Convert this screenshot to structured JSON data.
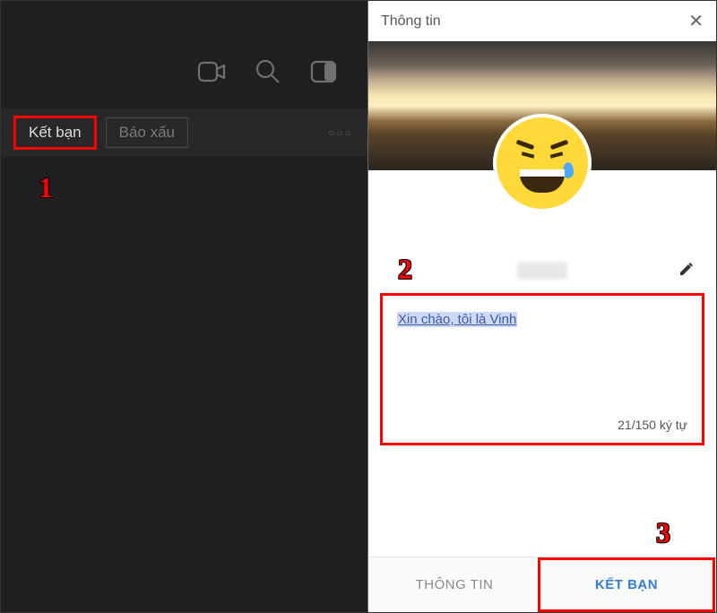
{
  "left": {
    "add_friend_label": "Kết bạn",
    "report_label": "Báo xấu"
  },
  "steps": {
    "one": "1",
    "two": "2",
    "three": "3"
  },
  "panel": {
    "title": "Thông tin",
    "message_text": "Xin chào, tôi là Vinh",
    "char_count": "21/150 ký tự",
    "footer_info": "THÔNG TIN",
    "footer_add": "KẾT BẠN"
  }
}
